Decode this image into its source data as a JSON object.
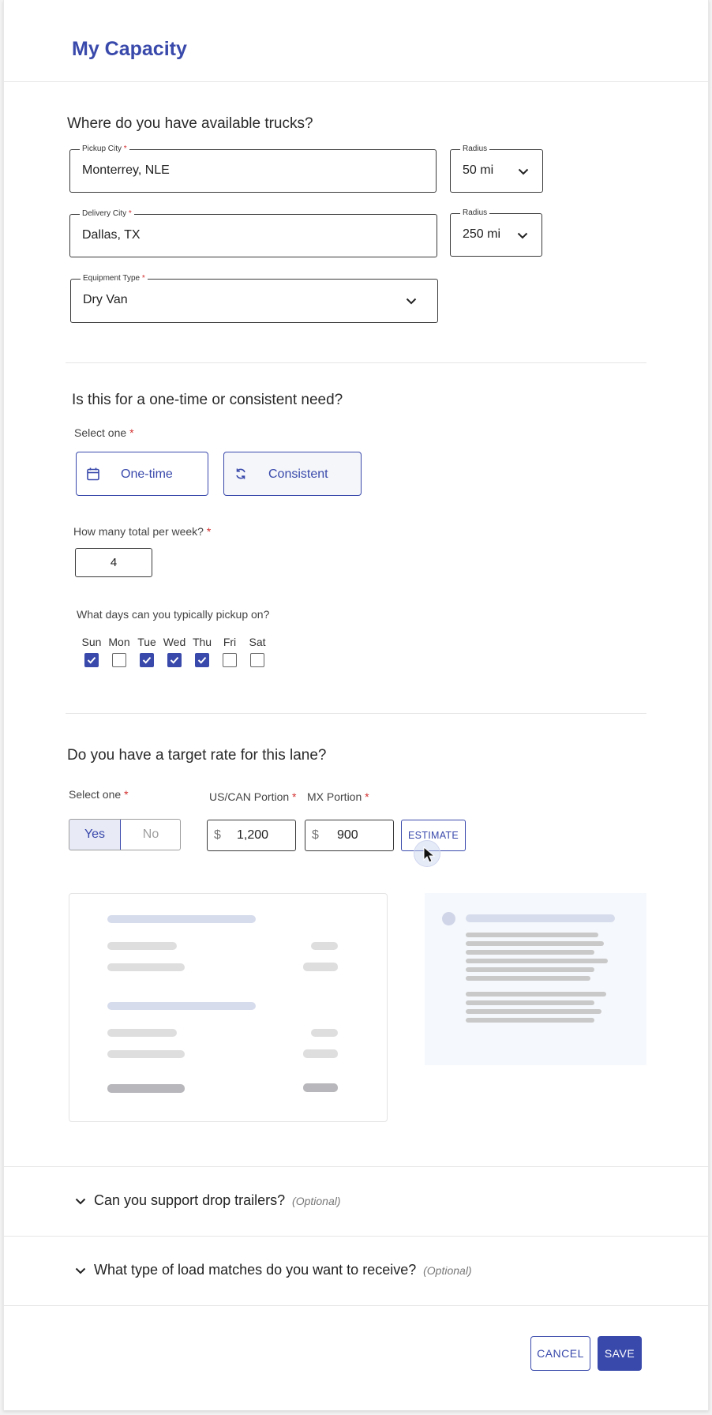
{
  "page": {
    "title": "My Capacity"
  },
  "trucks": {
    "heading": "Where do you have available trucks?",
    "pickup": {
      "label": "Pickup City",
      "required": "*",
      "value": "Monterrey, NLE"
    },
    "pickup_radius": {
      "label": "Radius",
      "value": "50 mi"
    },
    "delivery": {
      "label": "Delivery City",
      "required": "*",
      "value": "Dallas, TX"
    },
    "delivery_radius": {
      "label": "Radius",
      "value": "250 mi"
    },
    "equipment": {
      "label": "Equipment Type",
      "required": "*",
      "value": "Dry Van"
    }
  },
  "need": {
    "heading": "Is this for a one-time or consistent need?",
    "select_label": "Select one",
    "required": "*",
    "options": [
      "One-time",
      "Consistent"
    ],
    "selected": "Consistent",
    "per_week_label": "How many total per week?",
    "per_week_value": "4",
    "days_label": "What days can you typically pickup on?",
    "days": [
      {
        "label": "Sun",
        "checked": true
      },
      {
        "label": "Mon",
        "checked": false
      },
      {
        "label": "Tue",
        "checked": true
      },
      {
        "label": "Wed",
        "checked": true
      },
      {
        "label": "Thu",
        "checked": true
      },
      {
        "label": "Fri",
        "checked": false
      },
      {
        "label": "Sat",
        "checked": false
      }
    ]
  },
  "rate": {
    "heading": "Do you have a target rate for this lane?",
    "select_label": "Select one",
    "required": "*",
    "yes": "Yes",
    "no": "No",
    "selected": "Yes",
    "us_label": "US/CAN Portion",
    "mx_label": "MX Portion",
    "currency": "$",
    "us_value": "1,200",
    "mx_value": "900",
    "estimate": "ESTIMATE"
  },
  "accordions": [
    {
      "title": "Can you support drop trailers?",
      "optional": "(Optional)"
    },
    {
      "title": "What type of load matches do you want to receive?",
      "optional": "(Optional)"
    }
  ],
  "actions": {
    "cancel": "CANCEL",
    "save": "SAVE"
  },
  "colors": {
    "accent": "#3949ab",
    "required": "#d32f2f",
    "skeleton_panel": "#f5f8fc"
  }
}
